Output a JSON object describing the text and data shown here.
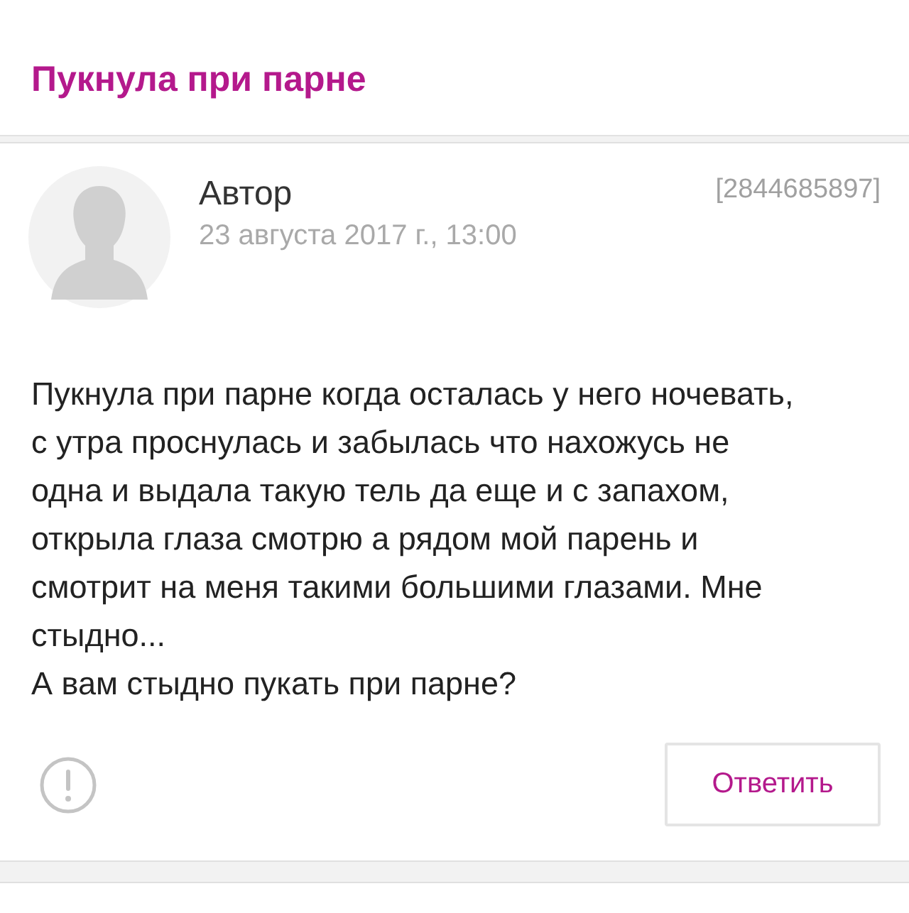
{
  "topic": {
    "title": "Пукнула при парне"
  },
  "post": {
    "author": "Автор",
    "date": "23 августа 2017 г., 13:00",
    "id": "[2844685897]",
    "text": "Пукнула при парне когда осталась у него ночевать, с утра проснулась и забылась что нахожусь не одна и выдала такую тель да еще и с запахом, открыла глаза смотрю а рядом мой парень и смотрит на меня такими большими глазами. Мне стыдно...\nА вам стыдно пукать при парне?",
    "reply_button": "Ответить"
  }
}
